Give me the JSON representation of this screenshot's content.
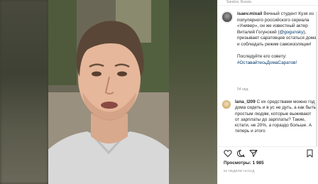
{
  "post": {
    "location": "Saratov, Russia",
    "author": "isaev.mixail",
    "caption_lines": [
      "Вечный студент Кузя из",
      "популярного российского сериала",
      "«Универ», он же известный актер",
      "Виталий Гогунский",
      "призывает саратовцев остаться",
      "дома и соблюдать режим",
      "самоизоляции!"
    ],
    "mention": "@gogunsky",
    "comma": ",",
    "caption_second_paragraph": "Последуйте его совету:",
    "hashtag": "#ОставайтесьДомаСаратов!",
    "time_ago": "54 нед.",
    "comment": {
      "author": "lana_l209",
      "text": "С их средствами можно год дома сидеть и в ус не дуть, а как быть простым людям, которые выживают от зарплаты до зарплаты? Такие, кстати, не 20%, а гораздо больше. А теперь и этого"
    },
    "views_label": "Просмотры:",
    "views_count": "1 985",
    "posted_ago": "54 НЕДЕЛИ НАЗАД"
  }
}
